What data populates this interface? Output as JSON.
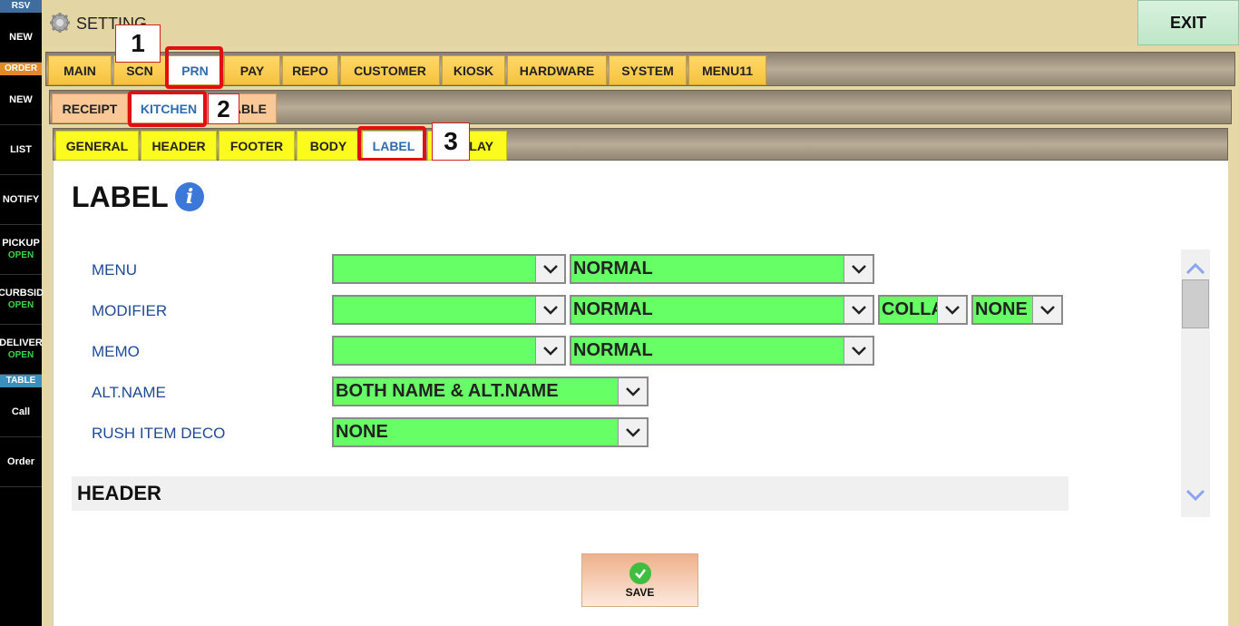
{
  "sidebar": {
    "rsv": "RSV",
    "rsv_new": "NEW",
    "order": "ORDER",
    "order_new": "NEW",
    "list": "LIST",
    "notify": "NOTIFY",
    "pickup": "PICKUP",
    "pickup_status": "OPEN",
    "curbside": "CURBSID",
    "curbside_status": "OPEN",
    "delivery": "DELIVER",
    "delivery_status": "OPEN",
    "table": "TABLE",
    "call": "Call",
    "order_btn": "Order"
  },
  "header": {
    "title": "SETTING",
    "exit": "EXIT"
  },
  "main_tabs": [
    "MAIN",
    "SCN",
    "PRN",
    "PAY",
    "REPO",
    "CUSTOMER",
    "KIOSK",
    "HARDWARE",
    "SYSTEM",
    "MENU11"
  ],
  "printer_tabs": [
    "RECEIPT",
    "KITCHEN",
    "ABLE"
  ],
  "kitchen_tabs": [
    "GENERAL",
    "HEADER",
    "FOOTER",
    "BODY",
    "LABEL",
    "LAY"
  ],
  "annotations": [
    "1",
    "2",
    "3"
  ],
  "page": {
    "title": "LABEL"
  },
  "rows": {
    "menu": {
      "label": "MENU",
      "font": "",
      "style": "NORMAL"
    },
    "modifier": {
      "label": "MODIFIER",
      "font": "",
      "style": "NORMAL",
      "collapse": "COLLA",
      "extra": "NONE"
    },
    "memo": {
      "label": "MEMO",
      "font": "",
      "style": "NORMAL"
    },
    "altname": {
      "label": "ALT.NAME",
      "value": "BOTH NAME & ALT.NAME"
    },
    "rush": {
      "label": "RUSH ITEM DECO",
      "value": "NONE"
    }
  },
  "section": {
    "header": "HEADER"
  },
  "save": "SAVE",
  "colors": {
    "field_green": "#66ff66",
    "tab_yellow": "#fbfb1e",
    "active_blue": "#2b6db0",
    "annotation_red": "#e01010"
  }
}
